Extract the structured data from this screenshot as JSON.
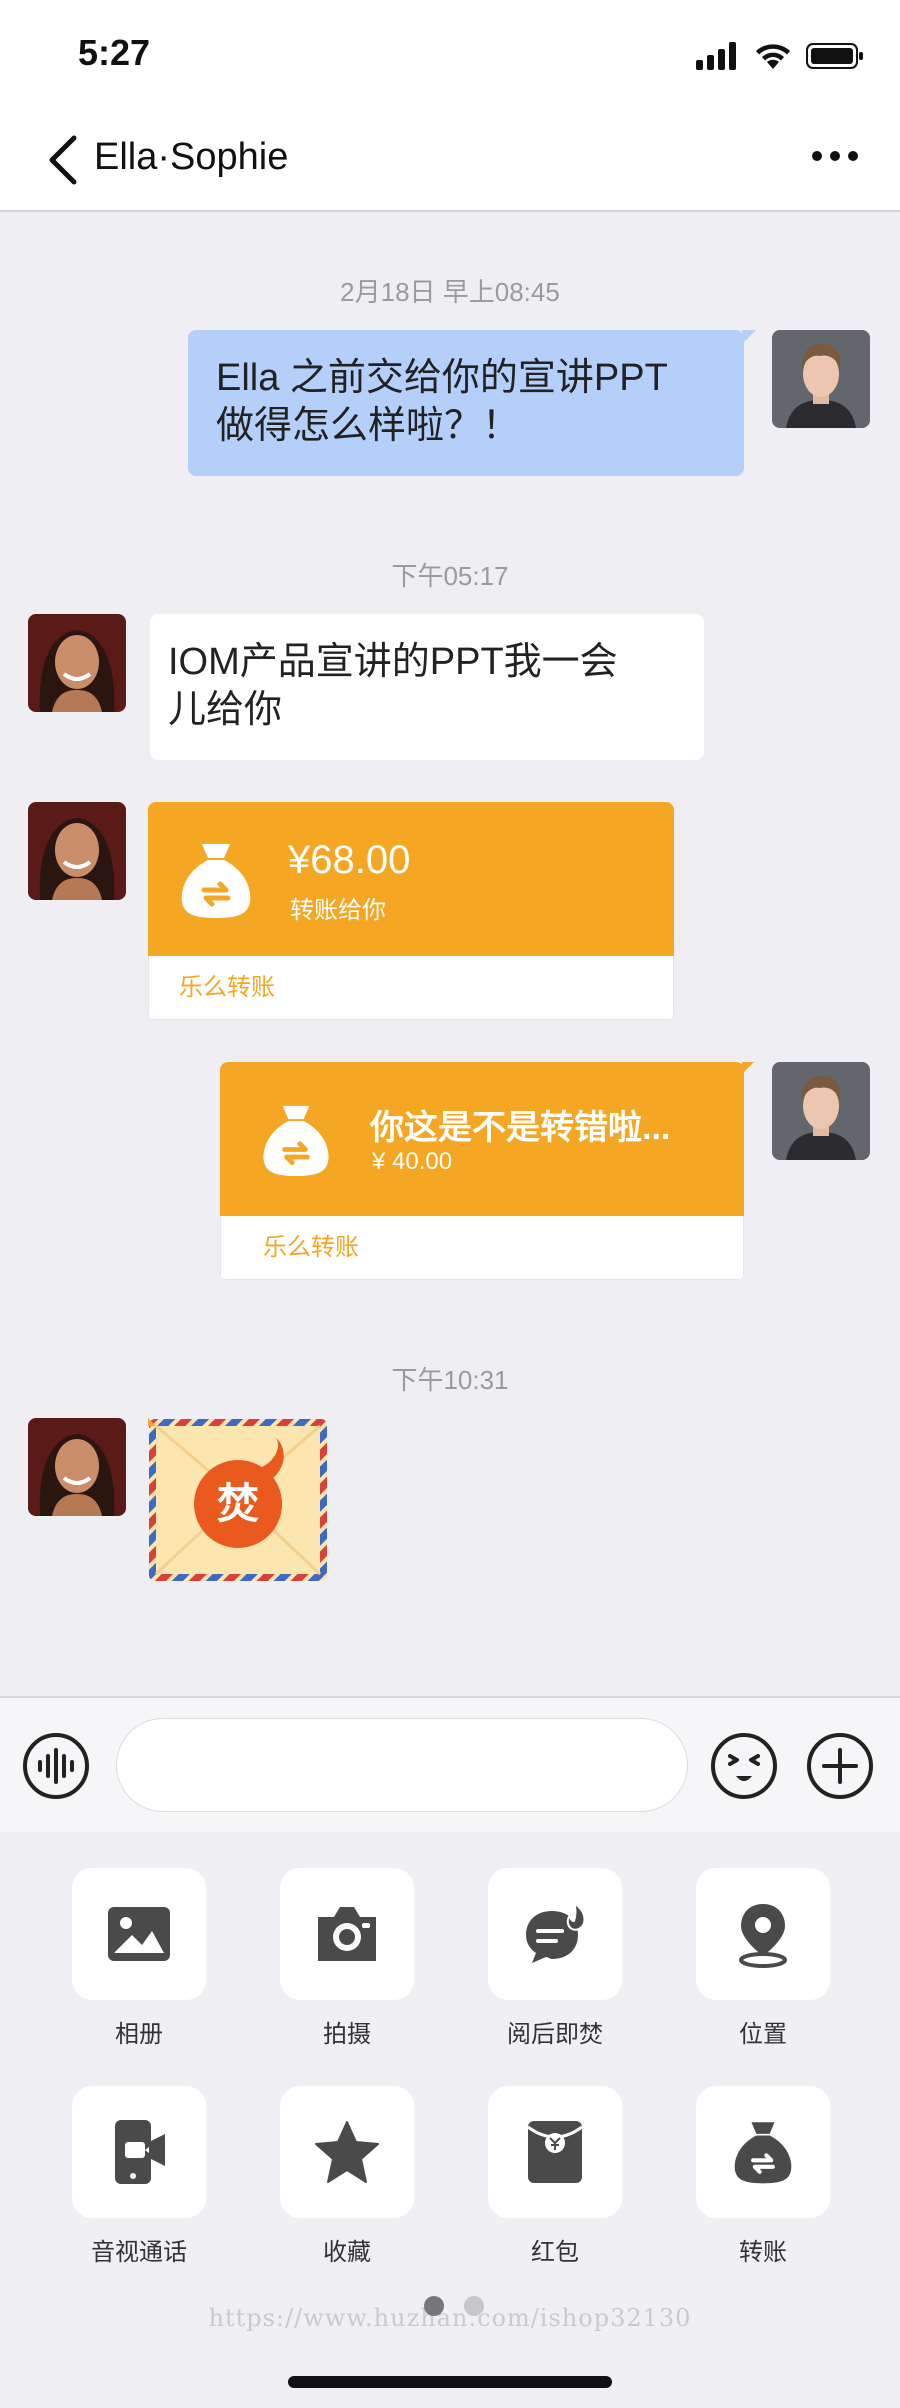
{
  "status_bar": {
    "time": "5:27"
  },
  "header": {
    "title": "Ella·Sophie"
  },
  "timestamps": [
    "2月18日 早上08:45",
    "下午05:17",
    "下午10:31"
  ],
  "messages": [
    {
      "sender": "me",
      "type": "text",
      "text_line1": "Ella 之前交给你的宣讲PPT",
      "text_line2": "做得怎么样啦？！"
    },
    {
      "sender": "other",
      "type": "text",
      "text_line1": "IOM产品宣讲的PPT我一会",
      "text_line2": "儿给你"
    },
    {
      "sender": "other",
      "type": "transfer",
      "amount": "¥68.00",
      "subtitle": "转账给你",
      "footer": "乐么转账"
    },
    {
      "sender": "me",
      "type": "transfer",
      "amount": "你这是不是转错啦...",
      "subtitle": "¥ 40.00",
      "footer": "乐么转账"
    },
    {
      "sender": "other",
      "type": "burn-after-reading",
      "badge": "焚"
    }
  ],
  "toolbar": {
    "items": [
      {
        "label": "相册",
        "icon": "photo-album-icon"
      },
      {
        "label": "拍摄",
        "icon": "camera-icon"
      },
      {
        "label": "阅后即焚",
        "icon": "burn-after-reading-icon"
      },
      {
        "label": "位置",
        "icon": "location-icon"
      },
      {
        "label": "音视通话",
        "icon": "video-call-icon"
      },
      {
        "label": "收藏",
        "icon": "star-icon"
      },
      {
        "label": "红包",
        "icon": "red-packet-icon"
      },
      {
        "label": "转账",
        "icon": "transfer-icon"
      }
    ]
  },
  "watermark": "https://www.huzhan.com/ishop32130",
  "colors": {
    "accent_orange": "#f5a623",
    "my_bubble": "#b3cffa",
    "icon_gray": "#4a4a4a"
  }
}
